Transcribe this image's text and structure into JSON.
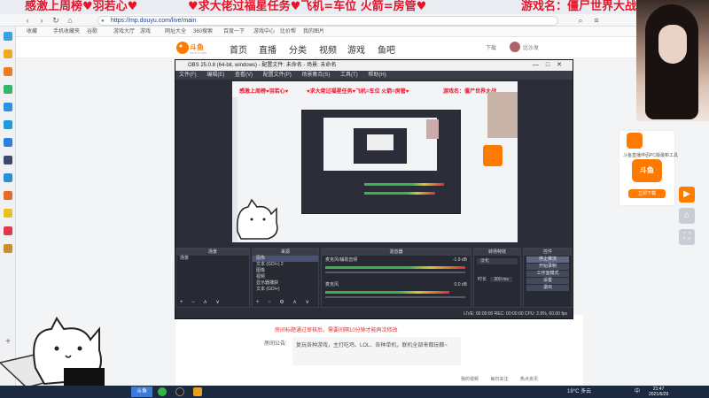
{
  "overlay": {
    "left_text": "感激上周榜♥羽若心♥",
    "mid_text": "♥求大佬过福星任务♥飞机=车位 火箭=房管♥",
    "right_text": "游戏名：僵尸世界大战"
  },
  "browser": {
    "url": "https://mp.douyu.com/live/main",
    "bookmarks": [
      "收藏",
      "手机收藏夹",
      "谷歌",
      "游戏大厅",
      "游戏",
      "网址大全",
      "360搜索",
      "百度一下",
      "游戏中心",
      "比价帮",
      "我的图片"
    ]
  },
  "douyu": {
    "logo": "斗鱼",
    "logo_sub": "DOUYU.COM",
    "nav": [
      "首页",
      "直播",
      "分类",
      "视频",
      "游戏",
      "鱼吧"
    ],
    "download": "下载",
    "user": "比沙发"
  },
  "obs": {
    "title": "OBS 25.0.8 (64-bit, windows) - 配置文件: 未命名 - 场景: 未命名",
    "menu": [
      "文件(F)",
      "编辑(E)",
      "查看(V)",
      "配置文件(P)",
      "场景集合(S)",
      "工具(T)",
      "帮助(H)"
    ],
    "preview_overlay_left": "感激上周榜♥羽若心♥",
    "preview_overlay_mid": "♥求大佬过福星任务♥飞机=车位 火箭=房管♥",
    "preview_overlay_right": "游戏名：僵尸世界大战",
    "docks": {
      "scenes": {
        "title": "场景",
        "items": [
          "场景"
        ]
      },
      "sources": {
        "title": "来源",
        "items": [
          "图像",
          "文本 (GDI+) 2",
          "图像",
          "视频",
          "显示器捕获",
          "文本 (GDI+)"
        ]
      },
      "mixer": {
        "title": "混音器",
        "tracks": [
          {
            "name": "麦克风/辅助音频",
            "db": "-1.9 dB"
          },
          {
            "name": "麦克风",
            "db": "0.0 dB"
          }
        ]
      },
      "transitions": {
        "title": "转场特效",
        "type": "淡化",
        "duration_label": "时长",
        "duration": "300 ms"
      },
      "controls": {
        "title": "控件",
        "buttons": [
          "停止推流",
          "开始录制",
          "工作室模式",
          "设置",
          "退出"
        ]
      }
    },
    "status": "LIVE: 00:00:00   REC: 00:00:00   CPU: 2.9%, 60.00 fps"
  },
  "page": {
    "notice_red": "房间标题通过审核后，需要间隔10分钟才能再次修改",
    "notice_label": "房间公告:",
    "notice_body": "复玩各种游戏，主打吃鸡、LOL、各种单机，联机全部来都玩都~"
  },
  "ad": {
    "title": "斗鱼直播伴侣PC版最新工具",
    "badge": "斗鱼",
    "button": "立即下载"
  },
  "status_bar": [
    "我的视频",
    "每日关注",
    "热点资讯"
  ],
  "taskbar": {
    "active_task": "斗鱼",
    "temp": "19°C 多云",
    "lang": "中",
    "time": "21:47",
    "date": "2021/6/29"
  },
  "colors": {
    "overlay_red": "#e8142a",
    "douyu_orange": "#ff7a00",
    "obs_bg": "#2b2e38",
    "taskbar": "#1b2a3e"
  }
}
